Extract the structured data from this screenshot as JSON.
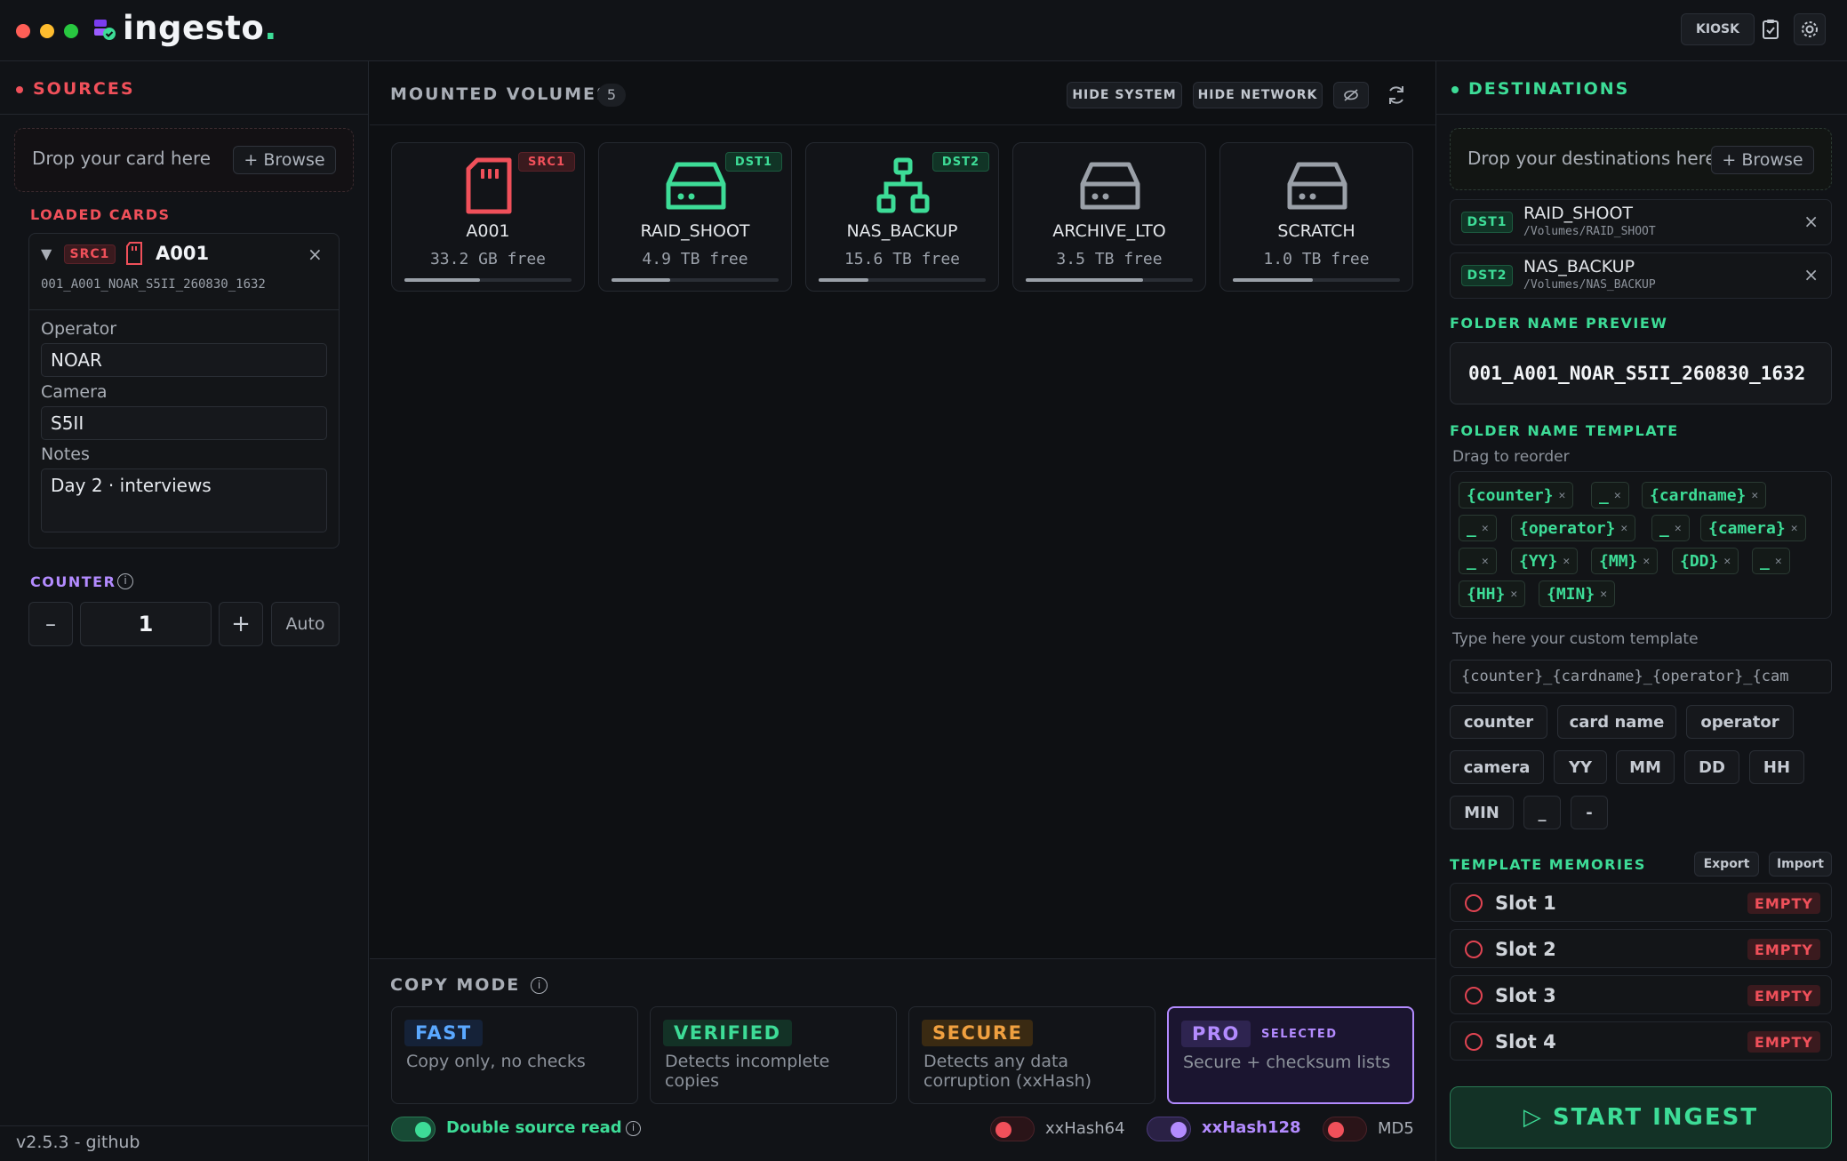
{
  "app": {
    "name": "ingesto",
    "name_accent": "."
  },
  "top": {
    "kiosk": "KIOSK"
  },
  "colors": {
    "bg": "#0e1013",
    "green": "#3ddc97",
    "red": "#f0505a",
    "purple": "#b38bff",
    "orange": "#f0a040",
    "blue": "#5aa8ff"
  },
  "sources": {
    "title": "SOURCES",
    "drop_text": "Drop your card here",
    "browse": "+ Browse",
    "loaded_title": "LOADED CARDS",
    "card": {
      "badge": "SRC1",
      "name": "A001",
      "folder": "001_A001_NOAR_S5II_260830_1632",
      "operator_label": "Operator",
      "operator": "NOAR",
      "camera_label": "Camera",
      "camera": "S5II",
      "notes_label": "Notes",
      "notes": "Day 2 · interviews"
    },
    "counter_title": "COUNTER",
    "counter_value": "1",
    "minus": "–",
    "plus": "+",
    "auto": "Auto",
    "version": "v2.5.3 - github"
  },
  "volumes": {
    "title": "MOUNTED VOLUMES",
    "count": "5",
    "hide_system": "HIDE SYSTEM",
    "hide_network": "HIDE NETWORK",
    "items": [
      {
        "name": "A001",
        "free": "33.2 GB free",
        "badge": "SRC1",
        "icon": "sd-card-icon",
        "usage": 0.45
      },
      {
        "name": "RAID_SHOOT",
        "free": "4.9 TB free",
        "badge": "DST1",
        "icon": "drive-icon",
        "usage": 0.35
      },
      {
        "name": "NAS_BACKUP",
        "free": "15.6 TB free",
        "badge": "DST2",
        "icon": "network-icon",
        "usage": 0.3
      },
      {
        "name": "ARCHIVE_LTO",
        "free": "3.5 TB free",
        "badge": "",
        "icon": "drive-icon",
        "usage": 0.7
      },
      {
        "name": "SCRATCH",
        "free": "1.0 TB free",
        "badge": "",
        "icon": "drive-icon",
        "usage": 0.48
      }
    ]
  },
  "copy_mode": {
    "title": "COPY MODE",
    "modes": [
      {
        "tag": "FAST",
        "desc": "Copy only, no checks"
      },
      {
        "tag": "VERIFIED",
        "desc": "Detects incomplete copies"
      },
      {
        "tag": "SECURE",
        "desc": "Detects any data corruption (xxHash)"
      },
      {
        "tag": "PRO",
        "desc": "Secure + checksum lists",
        "selected": "SELECTED"
      }
    ],
    "double_read": "Double source read",
    "hash1": "xxHash64",
    "hash2": "xxHash128",
    "hash3": "MD5"
  },
  "destinations": {
    "title": "DESTINATIONS",
    "drop_text": "Drop your destinations here",
    "browse": "+ Browse",
    "items": [
      {
        "badge": "DST1",
        "name": "RAID_SHOOT",
        "path": "/Volumes/RAID_SHOOT"
      },
      {
        "badge": "DST2",
        "name": "NAS_BACKUP",
        "path": "/Volumes/NAS_BACKUP"
      }
    ],
    "preview_title": "FOLDER NAME PREVIEW",
    "preview": "001_A001_NOAR_S5II_260830_1632",
    "template_title": "FOLDER NAME TEMPLATE",
    "drag_hint": "Drag to reorder",
    "chips": [
      "{counter}",
      "_",
      "{cardname}",
      "_",
      "{operator}",
      "_",
      "{camera}",
      "_",
      "{YY}",
      "{MM}",
      "{DD}",
      "_",
      "{HH}",
      "{MIN}"
    ],
    "custom_label": "Type here your custom template",
    "custom_value": "{counter}_{cardname}_{operator}_{cam",
    "tokens": [
      "counter",
      "card name",
      "operator",
      "camera",
      "YY",
      "MM",
      "DD",
      "HH",
      "MIN",
      "_",
      "-"
    ],
    "memories_title": "TEMPLATE MEMORIES",
    "export": "Export",
    "import": "Import",
    "slots": [
      {
        "label": "Slot 1",
        "status": "EMPTY"
      },
      {
        "label": "Slot 2",
        "status": "EMPTY"
      },
      {
        "label": "Slot 3",
        "status": "EMPTY"
      },
      {
        "label": "Slot 4",
        "status": "EMPTY"
      }
    ],
    "start": "▷ START INGEST"
  }
}
